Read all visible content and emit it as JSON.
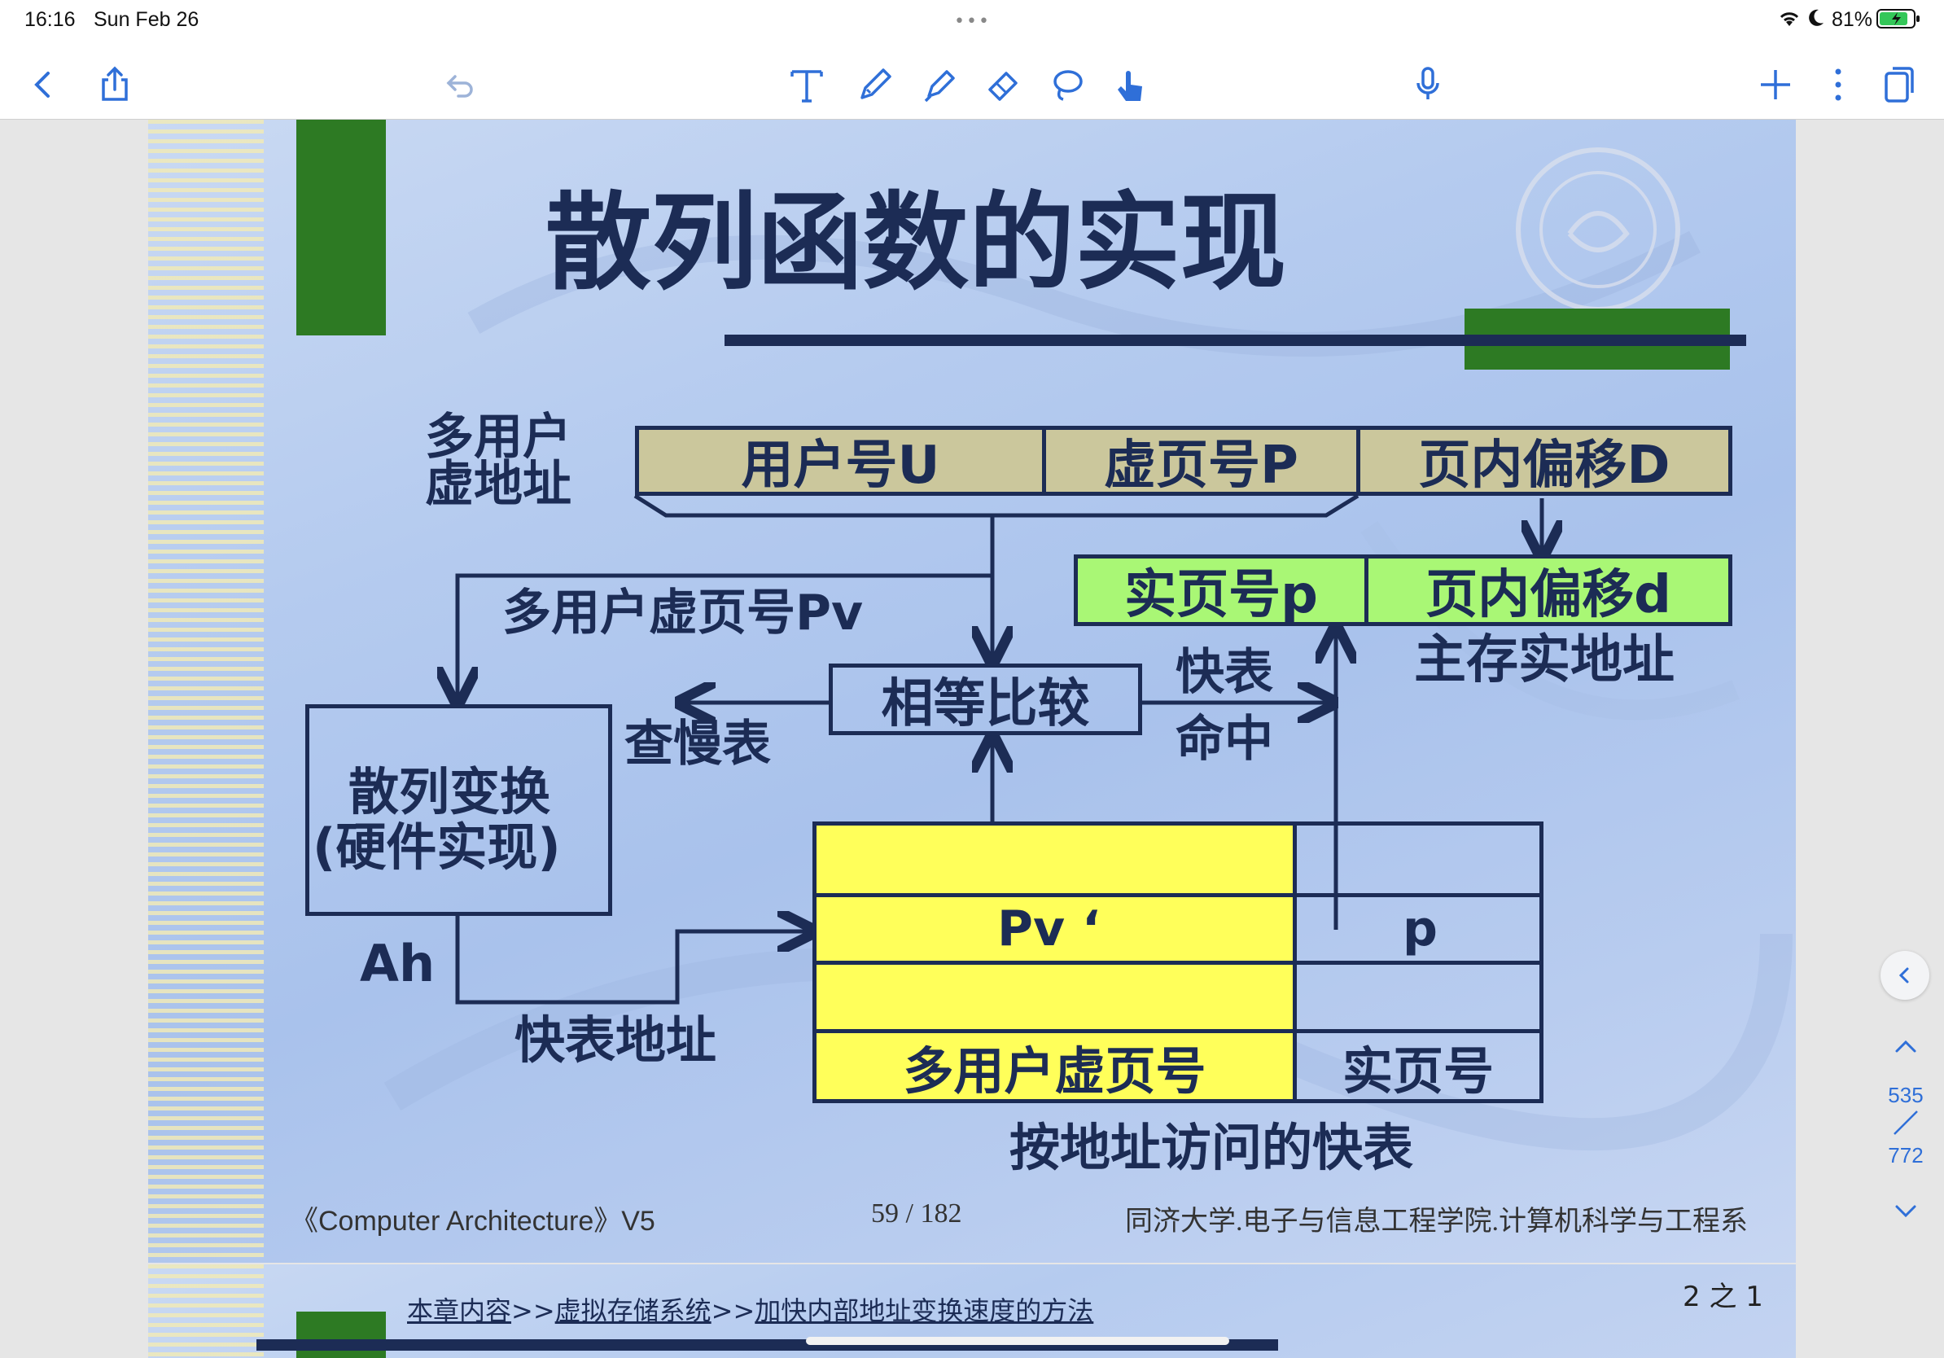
{
  "status": {
    "time": "16:16",
    "date": "Sun Feb 26",
    "battery": "81%"
  },
  "toolbar": {
    "back_icon": "chevron-left-icon",
    "share_icon": "share-icon",
    "undo_icon": "undo-icon",
    "tools": [
      "text-tool-icon",
      "pen-icon",
      "highlighter-icon",
      "eraser-icon",
      "lasso-icon",
      "hand-touch-icon"
    ],
    "mic_icon": "microphone-icon",
    "add_icon": "plus-icon",
    "more_icon": "more-vertical-icon",
    "pages_icon": "pages-icon",
    "accent": "#2f6fd8"
  },
  "slide": {
    "title": "散列函数的实现",
    "addr_label_line1": "多用户",
    "addr_label_line2": "虚地址",
    "field_user": "用户号U",
    "field_vpage": "虚页号P",
    "field_offset": "页内偏移D",
    "field_real_page": "实页号p",
    "field_real_offset": "页内偏移d",
    "main_addr": "主存实地址",
    "pv_label": "多用户虚页号Pv",
    "compare": "相等比较",
    "slow_table": "查慢表",
    "hit_line1": "快表",
    "hit_line2": "命中",
    "hash_line1": "散列变换",
    "hash_line2": "(硬件实现)",
    "ah": "Ah",
    "tlb_addr": "快表地址",
    "tlb_pv": "Pv  ‘",
    "tlb_p": "p",
    "tlb_col1": "多用户虚页号",
    "tlb_col2": "实页号",
    "tlb_caption": "按地址访问的快表",
    "footer_left": "《Computer Architecture》V5",
    "footer_center": "59 / 182",
    "footer_right": "同济大学.电子与信息工程学院.计算机科学与工程系",
    "page_of": "2 之 1",
    "breadcrumb1": "本章内容",
    "breadcrumb2": "虚拟存储系统",
    "breadcrumb3": "加快内部地址变换速度的方法",
    "breadcrumb_sep": ">>",
    "colors": {
      "navy": "#1c2c55",
      "green": "#2d7a23",
      "khaki": "#cbc79c",
      "lime": "#a9f775",
      "yellow": "#ffff5a"
    }
  },
  "sidebar": {
    "current_page": "535",
    "total_pages": "772"
  }
}
